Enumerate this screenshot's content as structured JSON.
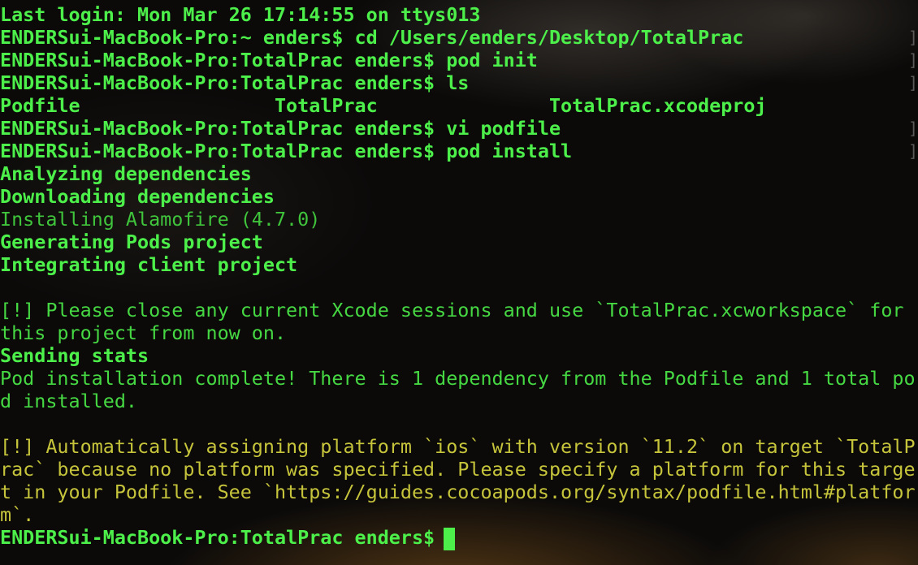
{
  "terminal": {
    "lines": [
      {
        "text": "Last login: Mon Mar 26 17:14:55 on ttys013",
        "style": "bright"
      },
      {
        "text": "ENDERSui-MacBook-Pro:~ enders$ cd /Users/enders/Desktop/TotalPrac",
        "style": "bright"
      },
      {
        "text": "ENDERSui-MacBook-Pro:TotalPrac enders$ pod init",
        "style": "bright"
      },
      {
        "text": "ENDERSui-MacBook-Pro:TotalPrac enders$ ls",
        "style": "bright"
      },
      {
        "text": "Podfile                 TotalPrac               TotalPrac.xcodeproj",
        "style": "bright"
      },
      {
        "text": "ENDERSui-MacBook-Pro:TotalPrac enders$ vi podfile",
        "style": "bright"
      },
      {
        "text": "ENDERSui-MacBook-Pro:TotalPrac enders$ pod install",
        "style": "bright"
      },
      {
        "text": "Analyzing dependencies",
        "style": "bright"
      },
      {
        "text": "Downloading dependencies",
        "style": "bright"
      },
      {
        "text": "Installing Alamofire (4.7.0)",
        "style": "dim"
      },
      {
        "text": "Generating Pods project",
        "style": "bright"
      },
      {
        "text": "Integrating client project",
        "style": "bright"
      },
      {
        "text": "",
        "style": "bright"
      },
      {
        "text": "[!] Please close any current Xcode sessions and use `TotalPrac.xcworkspace` for",
        "style": "green2"
      },
      {
        "text": "this project from now on.",
        "style": "green2"
      },
      {
        "text": "Sending stats",
        "style": "bright"
      },
      {
        "text": "Pod installation complete! There is 1 dependency from the Podfile and 1 total po",
        "style": "green2"
      },
      {
        "text": "d installed.",
        "style": "green2"
      },
      {
        "text": "",
        "style": "bright"
      },
      {
        "text": "[!] Automatically assigning platform `ios` with version `11.2` on target `TotalP",
        "style": "yellow"
      },
      {
        "text": "rac` because no platform was specified. Please specify a platform for this targe",
        "style": "yellow"
      },
      {
        "text": "t in your Podfile. See `https://guides.cocoapods.org/syntax/podfile.html#platfor",
        "style": "yellow"
      },
      {
        "text": "m`.",
        "style": "yellow"
      },
      {
        "text": "ENDERSui-MacBook-Pro:TotalPrac enders$ ",
        "style": "bright"
      }
    ],
    "right_markers": [
      "]",
      "]",
      "]",
      "]",
      "]",
      "]"
    ],
    "colors": {
      "bright": "#4df04a",
      "dim": "#3fc43c",
      "yellow": "#c6c43b",
      "background": "#0b0a09"
    }
  }
}
